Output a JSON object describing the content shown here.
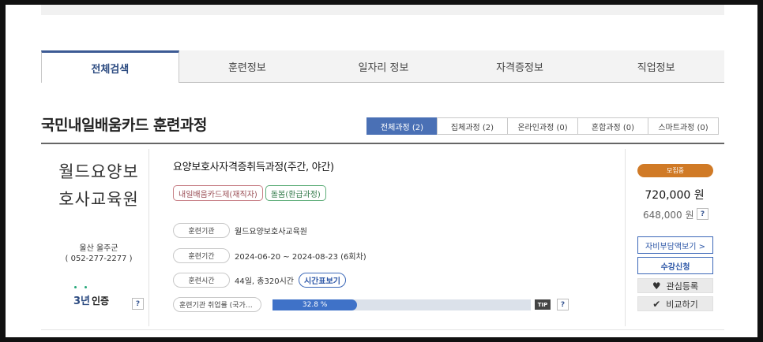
{
  "tabs": [
    {
      "label": "전체검색",
      "active": true
    },
    {
      "label": "훈련정보",
      "active": false
    },
    {
      "label": "일자리 정보",
      "active": false
    },
    {
      "label": "자격증정보",
      "active": false
    },
    {
      "label": "직업정보",
      "active": false
    }
  ],
  "page_title": "국민내일배움카드 훈련과정",
  "filters": [
    {
      "label": "전체과정 (2)",
      "active": true
    },
    {
      "label": "집체과정 (2)",
      "active": false
    },
    {
      "label": "온라인과정 (0)",
      "active": false
    },
    {
      "label": "혼합과정 (0)",
      "active": false
    },
    {
      "label": "스마트과정 (0)",
      "active": false
    }
  ],
  "org": {
    "name_line1": "월드요양보",
    "name_line2": "호사교육원",
    "location": "울산 울주군",
    "phone": "( 052-277-2277 )",
    "cert_num": "3년",
    "cert_label": "인증"
  },
  "course": {
    "title": "요양보호사자격증취득과정(주간, 야간)",
    "tags": [
      {
        "label": "내일배움카드제(재직자)",
        "color": "#c77f86"
      },
      {
        "label": "돌봄(환급과정)",
        "color": "#5fae7a"
      }
    ],
    "institution_label": "훈련기관",
    "institution_value": "월드요양보호사교육원",
    "period_label": "훈련기간",
    "period_value": "2024-06-20 ~ 2024-08-23 (6회차)",
    "hours_label": "훈련시간",
    "hours_value": "44일, 총320시간",
    "schedule_button": "시간표보기",
    "employment_label": "훈련기관 취업률 (국가…",
    "employment_rate_text": "32.8 %",
    "employment_rate": 32.8,
    "tip_label": "TIP"
  },
  "side": {
    "status": "모집중",
    "status_color": "#d07a26",
    "price": "720,000 원",
    "price_sub": "648,000 원",
    "self_pay_button": "자비부담액보기 >",
    "apply_button": "수강신청",
    "wish_button": "관심등록",
    "compare_button": "비교하기"
  },
  "help_glyph": "?",
  "accent_color": "#3c5a94"
}
